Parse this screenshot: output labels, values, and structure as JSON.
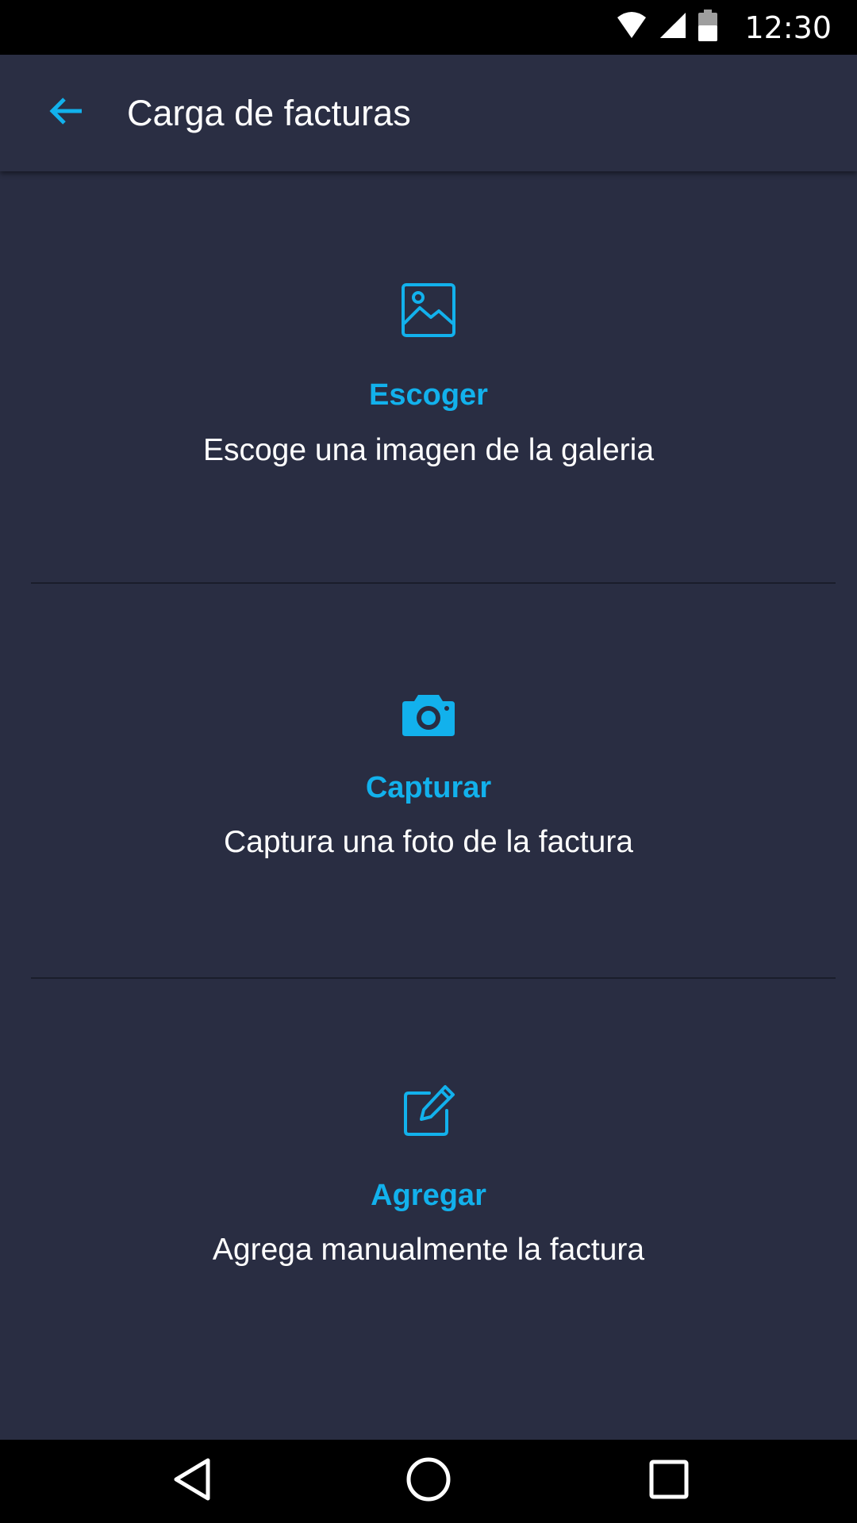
{
  "status_bar": {
    "time": "12:30",
    "icons": [
      "wifi-icon",
      "cellular-signal-icon",
      "battery-icon"
    ]
  },
  "app_bar": {
    "title": "Carga de facturas",
    "back_icon": "arrow-back-icon"
  },
  "options": [
    {
      "icon": "image-icon",
      "title": "Escoger",
      "description": "Escoge una imagen de la galeria"
    },
    {
      "icon": "camera-icon",
      "title": "Capturar",
      "description": "Captura una foto de la factura"
    },
    {
      "icon": "edit-icon",
      "title": "Agregar",
      "description": "Agrega manualmente la factura"
    }
  ],
  "nav_bar": {
    "buttons": [
      "back-nav-icon",
      "home-nav-icon",
      "recents-nav-icon"
    ]
  },
  "colors": {
    "background": "#292d42",
    "accent": "#12b1ec",
    "text": "#ffffff",
    "system_bars": "#000000"
  }
}
